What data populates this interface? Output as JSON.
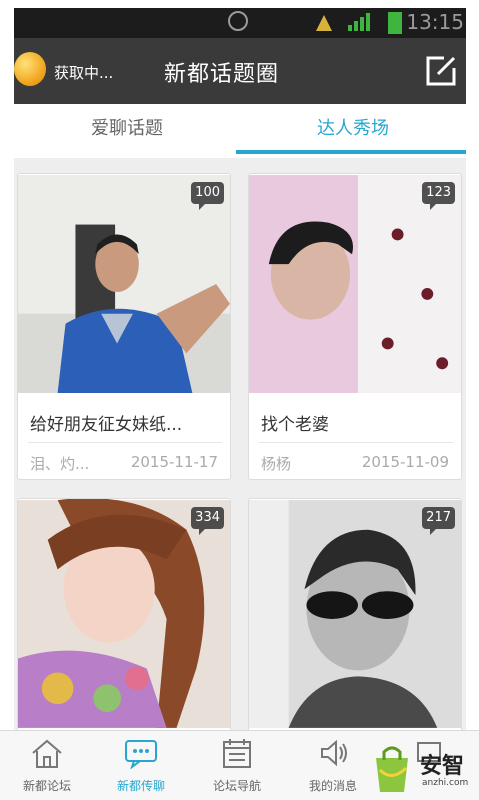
{
  "status_bar": {
    "time": "13:15"
  },
  "header": {
    "loading_text": "获取中...",
    "title": "新都话题圈"
  },
  "tabs": [
    {
      "label": "爱聊话题"
    },
    {
      "label": "达人秀场"
    }
  ],
  "cards": [
    {
      "count": "100",
      "caption": "给好朋友征女妹纸...",
      "author": "泪、灼...",
      "date": "2015-11-17"
    },
    {
      "count": "123",
      "caption": "找个老婆",
      "author": "杨杨",
      "date": "2015-11-09"
    },
    {
      "count": "334"
    },
    {
      "count": "217"
    }
  ],
  "bottom_nav": [
    {
      "label": "新都论坛",
      "icon": "home-icon"
    },
    {
      "label": "新都传聊",
      "icon": "chat-icon"
    },
    {
      "label": "论坛导航",
      "icon": "calendar-icon"
    },
    {
      "label": "我的消息",
      "icon": "speaker-icon"
    },
    {
      "label": "",
      "icon": "more-icon"
    }
  ],
  "watermark": {
    "text": "安智",
    "url": "anzhi.com"
  },
  "colors": {
    "accent": "#29a6cf",
    "header_bg": "#3a3a3a",
    "status_bg": "#1c1c1c"
  }
}
